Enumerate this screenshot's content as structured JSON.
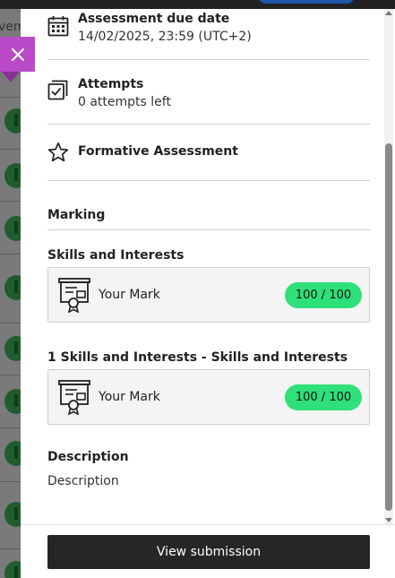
{
  "background": {
    "heading_fragment": "vem"
  },
  "close_button": {
    "icon": "close-icon",
    "color": "#b94bc9"
  },
  "details": {
    "due_date": {
      "icon": "calendar-icon",
      "title": "Assessment due date",
      "value": "14/02/2025, 23:59 (UTC+2)"
    },
    "attempts": {
      "icon": "attempts-icon",
      "title": "Attempts",
      "value": "0 attempts left"
    },
    "assessment_type": {
      "icon": "star-icon",
      "title": "Formative Assessment"
    }
  },
  "marking": {
    "heading": "Marking",
    "groups": [
      {
        "title": "Skills and Interests",
        "mark_label": "Your Mark",
        "score": "100 / 100",
        "icon": "certificate-icon"
      },
      {
        "title": "1 Skills and Interests - Skills and Interests",
        "mark_label": "Your Mark",
        "score": "100 / 100",
        "icon": "certificate-icon"
      }
    ]
  },
  "description": {
    "heading": "Description",
    "text": "Description"
  },
  "footer": {
    "button_label": "View submission"
  },
  "colors": {
    "score_pill": "#2fe07a",
    "primary_button": "#262626",
    "overlay": "#6f6f6f"
  }
}
